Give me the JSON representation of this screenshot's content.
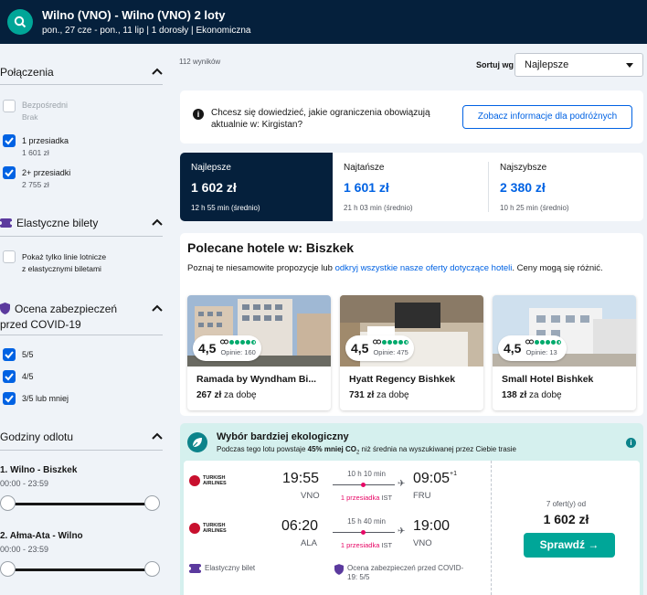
{
  "header": {
    "title": "Wilno (VNO) - Wilno (VNO) 2 loty",
    "subtitle": "pon., 27 cze - pon., 11 lip | 1 dorosły | Ekonomiczna"
  },
  "sidebar": {
    "connections": {
      "title": "Połączenia",
      "options": [
        {
          "label": "Bezpośredni",
          "sub": "Brak",
          "checked": false
        },
        {
          "label": "1 przesiadka",
          "sub": "1 601 zł",
          "checked": true
        },
        {
          "label": "2+ przesiadki",
          "sub": "2 755 zł",
          "checked": true
        }
      ]
    },
    "flexible": {
      "title": "Elastyczne bilety",
      "option_line1": "Pokaż tylko linie lotnicze",
      "option_line2": "z elastycznymi biletami"
    },
    "covid": {
      "title_line1": "Ocena zabezpieczeń",
      "title_line2": "przed COVID-19",
      "options": [
        "5/5",
        "4/5",
        "3/5 lub mniej"
      ]
    },
    "departure": {
      "title": "Godziny odlotu",
      "legs": [
        {
          "title": "1. Wilno - Biszkek",
          "range": "00:00 - 23:59"
        },
        {
          "title": "2. Ałma-Ata - Wilno",
          "range": "00:00 - 23:59"
        }
      ]
    }
  },
  "results": {
    "count": "112 wyników",
    "sort_label": "Sortuj wg",
    "sort_value": "Najlepsze"
  },
  "info": {
    "text": "Chcesz się dowiedzieć, jakie ograniczenia obowiązują aktualnie w: Kirgistan?",
    "button": "Zobacz informacje dla podróżnych"
  },
  "tabs": [
    {
      "label": "Najlepsze",
      "price": "1 602 zł",
      "detail": "12 h 55 min (średnio)"
    },
    {
      "label": "Najtańsze",
      "price": "1 601 zł",
      "detail": "21 h 03 min (średnio)"
    },
    {
      "label": "Najszybsze",
      "price": "2 380 zł",
      "detail": "10 h 25 min (średnio)"
    }
  ],
  "hotels": {
    "title": "Polecane hotele w: Biszkek",
    "desc_prefix": "Poznaj te niesamowite propozycje lub ",
    "desc_link": "odkryj wszystkie nasze oferty dotyczące hoteli",
    "desc_suffix": ". Ceny mogą się różnić.",
    "items": [
      {
        "rating": "4,5",
        "reviews": "Opinie: 160",
        "name": "Ramada by Wyndham Bi...",
        "price": "267 zł",
        "per": "za dobę"
      },
      {
        "rating": "4,5",
        "reviews": "Opinie: 475",
        "name": "Hyatt Regency Bishkek",
        "price": "731 zł",
        "per": "za dobę"
      },
      {
        "rating": "4,5",
        "reviews": "Opinie: 13",
        "name": "Small Hotel Bishkek",
        "price": "138 zł",
        "per": "za dobę"
      }
    ]
  },
  "eco": {
    "title": "Wybór bardziej ekologiczny",
    "sub_prefix": "Podczas tego lotu powstaje ",
    "sub_bold": "45% mniej CO",
    "sub_co_sub": "2",
    "sub_suffix": " niż średnia na wyszukiwanej przez Ciebie trasie",
    "info_icon": "i"
  },
  "flight": {
    "airline_line1": "TURKISH",
    "airline_line2": "AIRLINES",
    "legs": [
      {
        "dep_time": "19:55",
        "dep_apt": "VNO",
        "duration": "10 h 10 min",
        "stops": "1 przesiadka",
        "via": "IST",
        "arr_time": "09:05",
        "arr_plus": "+1",
        "arr_apt": "FRU"
      },
      {
        "dep_time": "06:20",
        "dep_apt": "ALA",
        "duration": "15 h 40 min",
        "stops": "1 przesiadka",
        "via": "IST",
        "arr_time": "19:00",
        "arr_plus": "",
        "arr_apt": "VNO"
      }
    ],
    "flex_label": "Elastyczny bilet",
    "covid_label_line1": "Ocena zabezpieczeń przed COVID-",
    "covid_label_line2": "19: 5/5",
    "offers": "7 ofert(y) od",
    "price": "1 602 zł",
    "cta": "Sprawdź →"
  },
  "colors": {
    "header_bg": "#05203c",
    "accent_blue": "#0062e3",
    "teal": "#00a698",
    "eco_bg": "#d5f0ee",
    "stops_pink": "#e70866"
  }
}
